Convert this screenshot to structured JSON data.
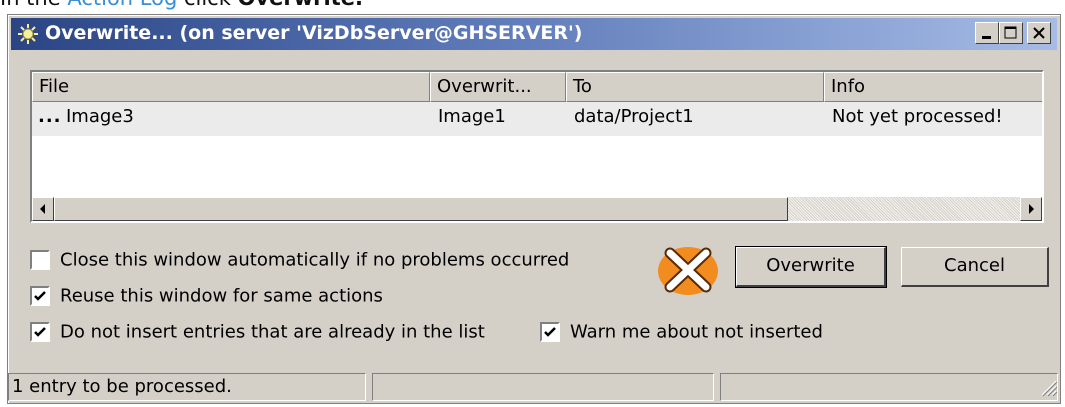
{
  "caption": {
    "prefix": "In the ",
    "link": "Action Log",
    "middle": " click ",
    "action": "Overwrite."
  },
  "window": {
    "title": "Overwrite... (on server 'VizDbServer@GHSERVER')",
    "title_icon": "gear-icon",
    "controls": [
      "minimize-icon",
      "maximize-icon",
      "close-icon"
    ]
  },
  "list": {
    "columns": [
      "File",
      "Overwrit...",
      "To",
      "Info"
    ],
    "rows": [
      {
        "status": "...",
        "file": "Image3",
        "overwrite": "Image1",
        "to": "data/Project1",
        "info": "Not yet processed!"
      }
    ],
    "scrollbar": {
      "left_icon": "arrow-left-icon",
      "right_icon": "arrow-right-icon",
      "thumb_fraction": 0.76
    }
  },
  "options": {
    "close_auto": {
      "label": "Close this window automatically if no problems occurred",
      "checked": false
    },
    "reuse": {
      "label": "Reuse this window for same actions",
      "checked": true
    },
    "no_insert": {
      "label": "Do not insert entries that are already in the list",
      "checked": true
    },
    "warn": {
      "label": "Warn me about not inserted",
      "checked": true
    }
  },
  "buttons": {
    "overwrite_icon": "orange-cross-icon",
    "overwrite": "Overwrite",
    "cancel": "Cancel"
  },
  "status": {
    "text": "1 entry to be processed.",
    "panel2": "",
    "panel3": ""
  },
  "colors": {
    "title_start": "#2a4484",
    "title_end": "#a6bce6",
    "face": "#d4d0c8",
    "icon_orange": "#f28c1e",
    "link": "#3a8fd6"
  }
}
